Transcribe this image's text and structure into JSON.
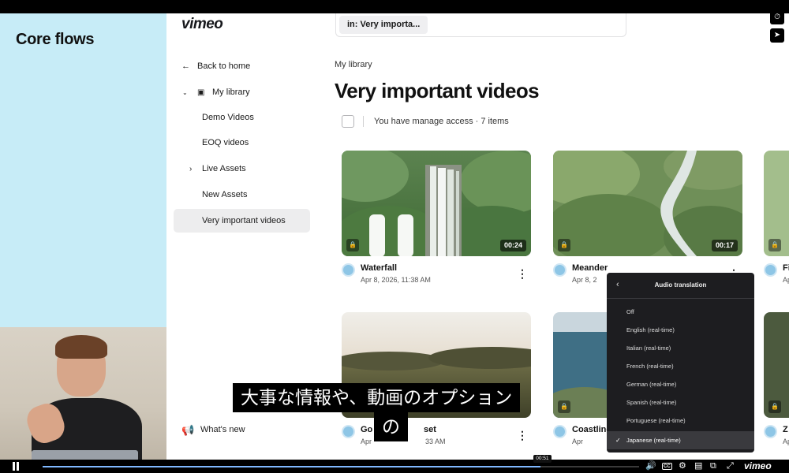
{
  "presenter_panel": {
    "title": "Core flows"
  },
  "sidebar": {
    "logo": "vimeo",
    "back": "Back to home",
    "my_library": "My library",
    "items": [
      "Demo Videos",
      "EOQ videos",
      "Live Assets",
      "New Assets",
      "Very important videos"
    ],
    "whats_new": "What's new"
  },
  "main": {
    "search_filter": "in: Very importa...",
    "breadcrumb": "My library",
    "title": "Very important videos",
    "access_text": "You have manage access · 7 items",
    "videos": [
      {
        "title": "Waterfall",
        "date": "Apr 8, 2026, 11:38 AM",
        "duration": "00:24"
      },
      {
        "title": "Meander",
        "date": "Apr 8, 2",
        "duration": "00:17"
      },
      {
        "title": "Fi",
        "date": "Ap",
        "duration": ""
      },
      {
        "title": "Go",
        "date": "Apr",
        "duration": "",
        "title_tail": "set",
        "date_tail": "33 AM"
      },
      {
        "title": "Coastline",
        "date": "Apr",
        "duration": ""
      },
      {
        "title": "Z",
        "date": "Ap",
        "duration": ""
      }
    ]
  },
  "audio_menu": {
    "title": "Audio translation",
    "options": [
      "Off",
      "English (real-time)",
      "Italian (real-time)",
      "French (real-time)",
      "German (real-time)",
      "Spanish (real-time)",
      "Portuguese (real-time)",
      "Japanese (real-time)"
    ],
    "selected": "Japanese (real-time)"
  },
  "subtitle": {
    "line1": "大事な情報や、動画のオプション",
    "line2": "の"
  },
  "player": {
    "time": "00:51",
    "progress": 0.835,
    "cc_label": "CC",
    "logo": "vimeo"
  }
}
